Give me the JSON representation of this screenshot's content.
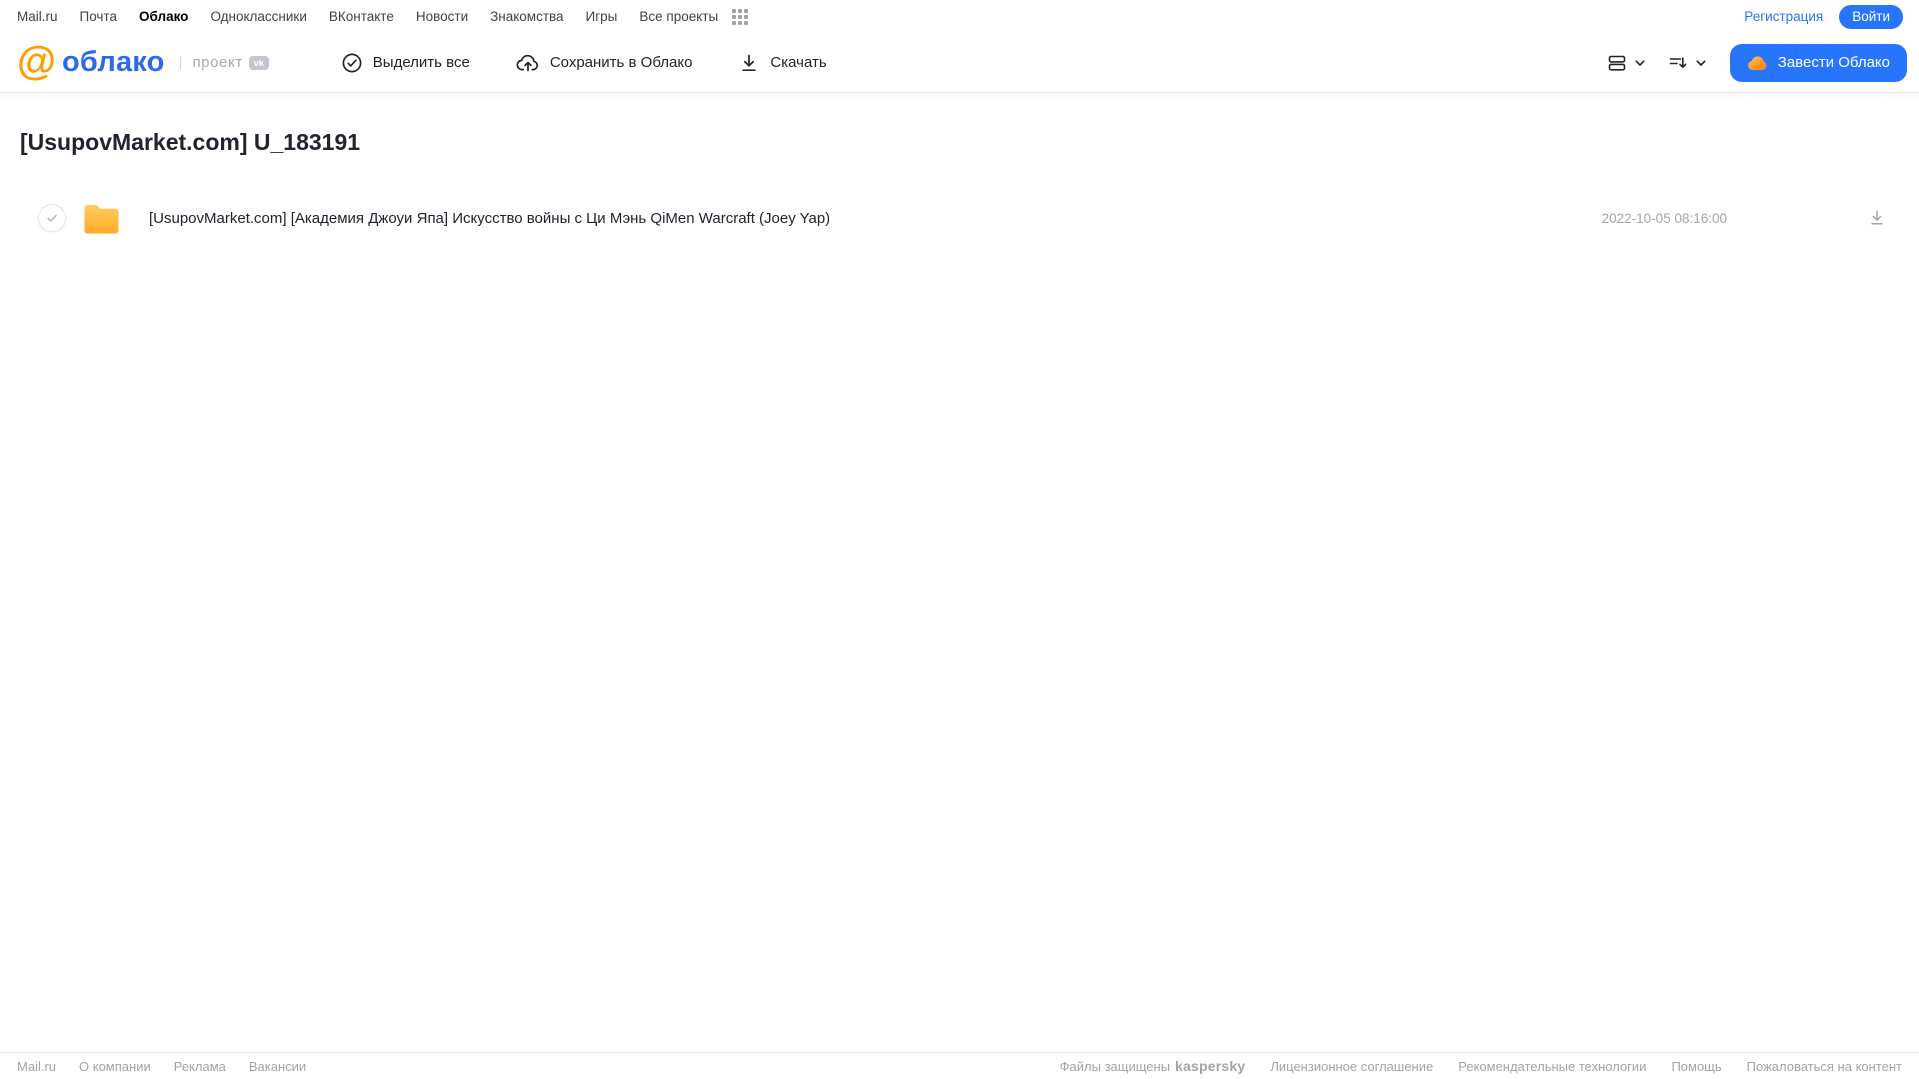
{
  "topnav": {
    "links": [
      "Mail.ru",
      "Почта",
      "Облако",
      "Одноклассники",
      "ВКонтакте",
      "Новости",
      "Знакомства",
      "Игры",
      "Все проекты"
    ],
    "registration_label": "Регистрация",
    "login_label": "Войти"
  },
  "header": {
    "logo_at": "@",
    "logo_word": "облако",
    "project_label": "проект",
    "vk_badge": "vk",
    "toolbar": {
      "select_all": "Выделить все",
      "save_to_cloud": "Сохранить в Облако",
      "download": "Скачать"
    },
    "get_cloud_label": "Завести Облако"
  },
  "main": {
    "title": "[UsupovMarket.com] U_183191",
    "files": [
      {
        "type": "folder",
        "name": "[UsupovMarket.com] [Академия Джоуи Япа] Искусство войны с Ци Мэнь QiMen Warcraft (Joey Yap)",
        "date": "2022-10-05 08:16:00"
      }
    ]
  },
  "footer": {
    "left_links": [
      "Mail.ru",
      "О компании",
      "Реклама",
      "Вакансии"
    ],
    "protected_text": "Файлы защищены",
    "kaspersky_label": "kaspersky",
    "right_links": [
      "Лицензионное соглашение",
      "Рекомендательные технологии",
      "Помощь",
      "Пожаловаться на контент"
    ]
  },
  "colors": {
    "accent_blue": "#2775fc",
    "logo_orange": "#ff9e00",
    "logo_blue": "#2b6ce6",
    "kaspersky_green": "#00a88e",
    "folder_top": "#ffcd5e",
    "folder_bottom": "#ffa929",
    "muted_gray": "#a3a6ac"
  }
}
